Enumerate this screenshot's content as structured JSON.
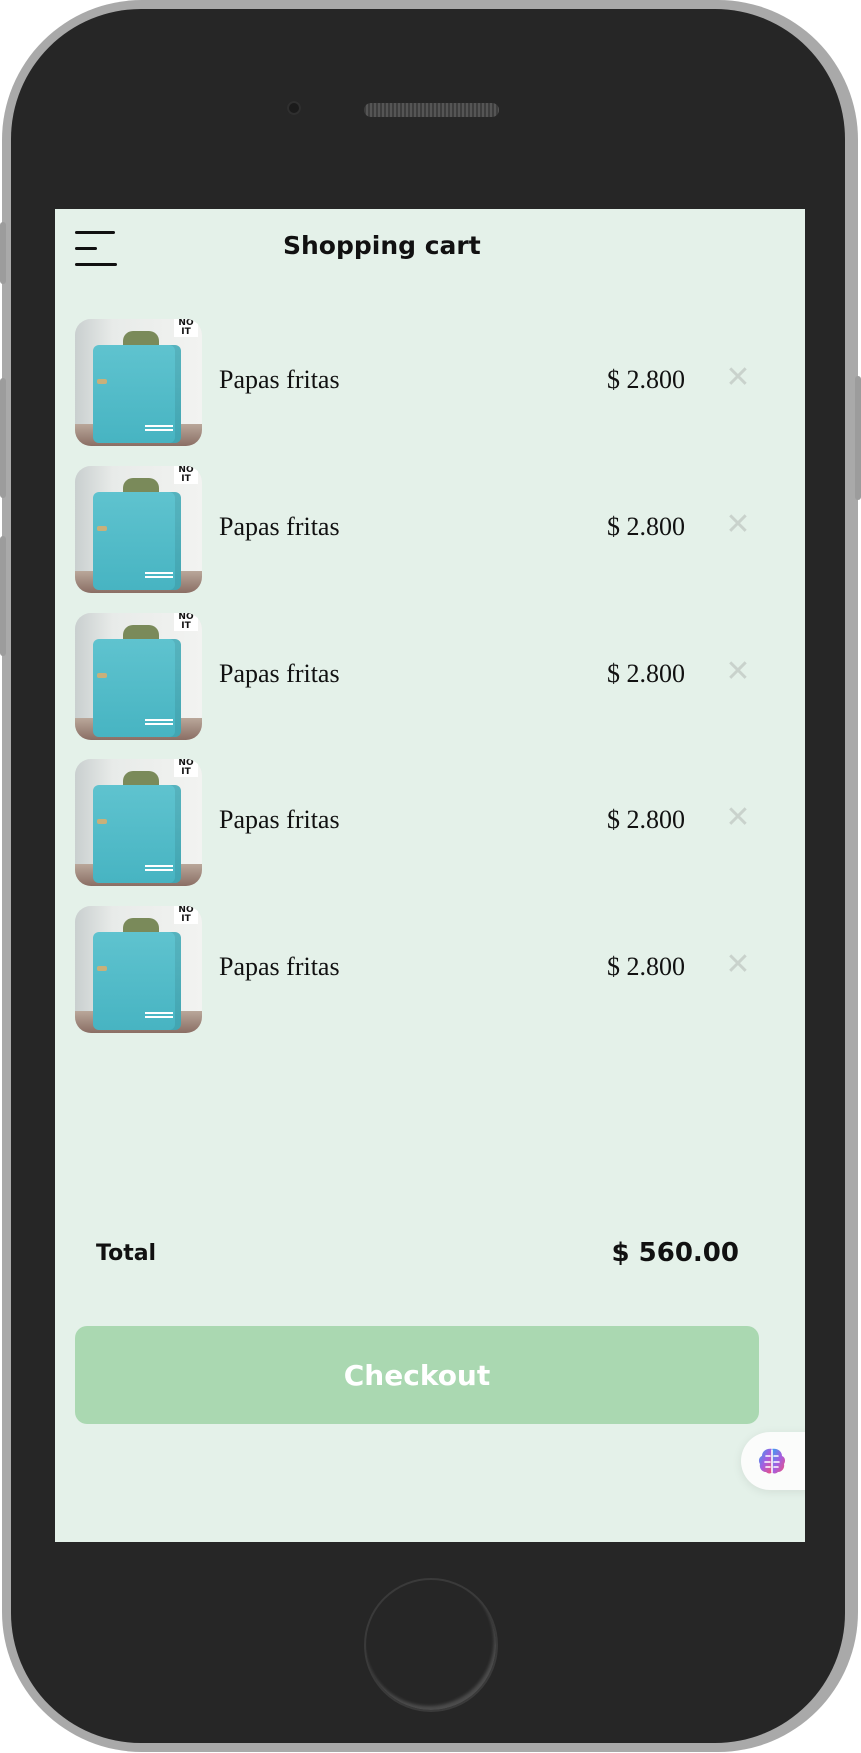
{
  "header": {
    "title": "Shopping cart",
    "menu_icon": "hamburger-menu-icon"
  },
  "cart": {
    "items": [
      {
        "name": "Papas fritas",
        "price": "$ 2.800",
        "remove_icon": "close-icon"
      },
      {
        "name": "Papas fritas",
        "price": "$ 2.800",
        "remove_icon": "close-icon"
      },
      {
        "name": "Papas fritas",
        "price": "$ 2.800",
        "remove_icon": "close-icon"
      },
      {
        "name": "Papas fritas",
        "price": "$ 2.800",
        "remove_icon": "close-icon"
      },
      {
        "name": "Papas fritas",
        "price": "$ 2.800",
        "remove_icon": "close-icon"
      }
    ],
    "total_label": "Total",
    "total_value": "$ 560.00"
  },
  "actions": {
    "checkout_label": "Checkout"
  },
  "assistant": {
    "icon": "brain-icon"
  },
  "colors": {
    "screen_background": "#e4f1e9",
    "checkout_button": "#aad8b1",
    "phone_body": "#262626"
  }
}
